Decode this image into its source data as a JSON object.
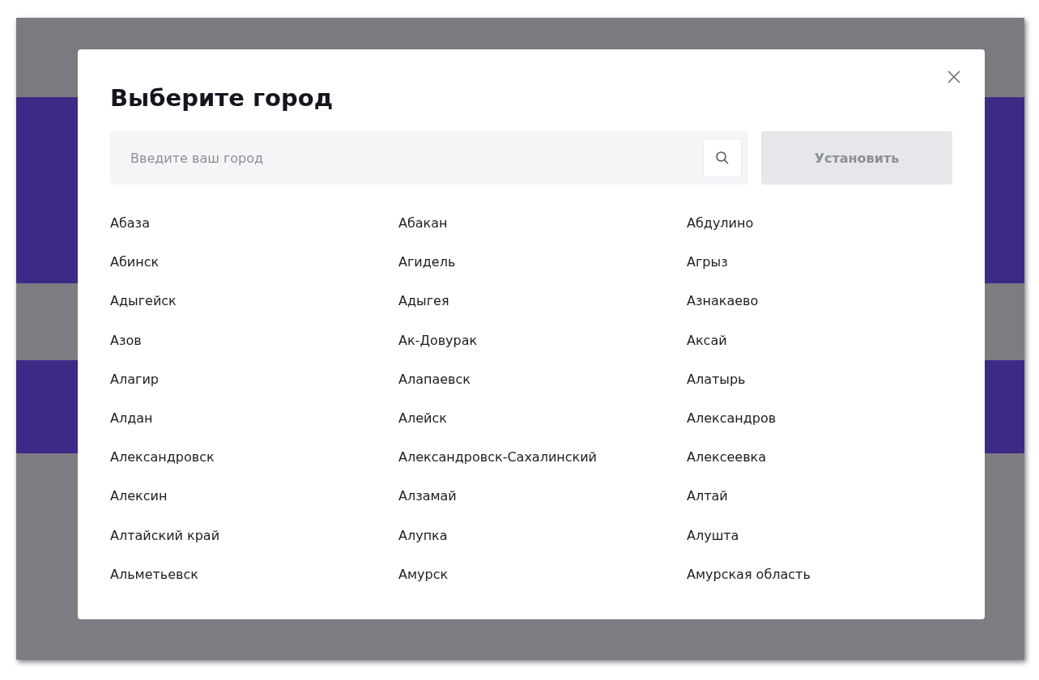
{
  "dialog": {
    "title": "Выберите город",
    "search": {
      "placeholder": "Введите ваш город"
    },
    "apply_button": {
      "label": "Установить",
      "disabled": true
    },
    "cities": [
      "Абаза",
      "Абакан",
      "Абдулино",
      "Абинск",
      "Агидель",
      "Агрыз",
      "Адыгейск",
      "Адыгея",
      "Азнакаево",
      "Азов",
      "Ак-Довурак",
      "Аксай",
      "Алагир",
      "Алапаевск",
      "Алатырь",
      "Алдан",
      "Алейск",
      "Александров",
      "Александровск",
      "Александровск-Сахалинский",
      "Алексеевка",
      "Алексин",
      "Алзамай",
      "Алтай",
      "Алтайский край",
      "Алупка",
      "Алушта",
      "Альметьевск",
      "Амурск",
      "Амурская область"
    ]
  }
}
